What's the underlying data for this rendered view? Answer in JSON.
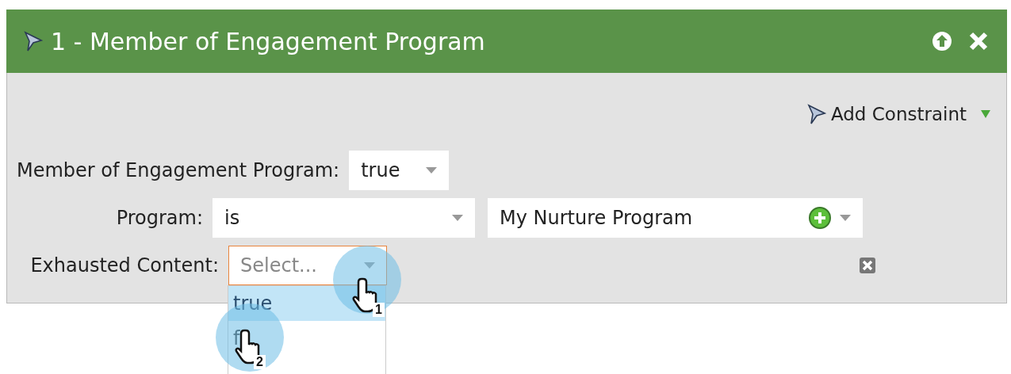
{
  "panel": {
    "title": "1 - Member of Engagement Program",
    "add_constraint": "Add Constraint",
    "rows": [
      {
        "label": "Member of Engagement Program:",
        "removable": false,
        "fields": [
          {
            "value": "true",
            "add": false,
            "focused": false
          }
        ]
      },
      {
        "label": "Program:",
        "removable": false,
        "fields": [
          {
            "value": "is",
            "add": false,
            "focused": false
          },
          {
            "value": "My Nurture Program",
            "add": true,
            "focused": false
          }
        ]
      },
      {
        "label": "Exhausted Content:",
        "removable": true,
        "fields": [
          {
            "placeholder": "Select...",
            "add": false,
            "focused": true
          }
        ]
      }
    ],
    "dropdown": {
      "options": [
        {
          "label": "true",
          "selected": true
        },
        {
          "label": "f",
          "selected": false
        }
      ]
    },
    "callouts": [
      "1",
      "2"
    ]
  }
}
